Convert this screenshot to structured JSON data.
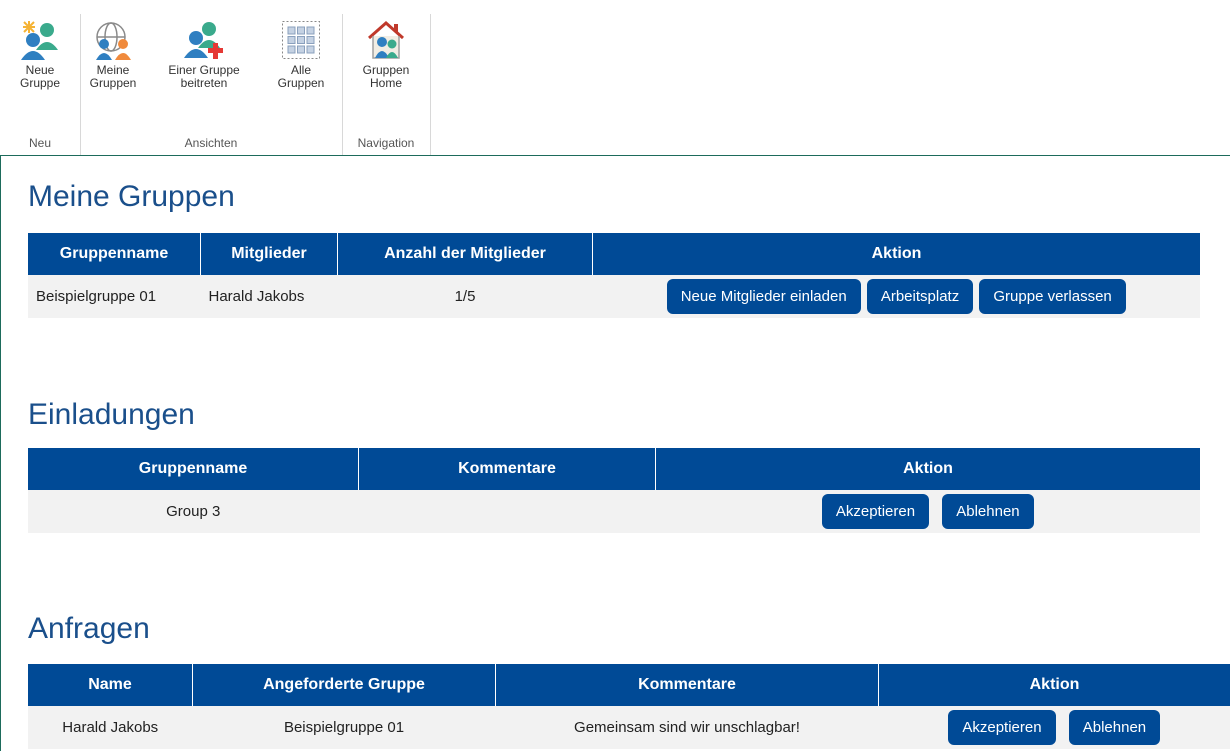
{
  "ribbon": {
    "groups": [
      {
        "label": "Neu",
        "buttons": [
          {
            "label": "Neue\nGruppe",
            "icon": "new-group-icon"
          }
        ]
      },
      {
        "label": "Ansichten",
        "buttons": [
          {
            "label": "Meine\nGruppen",
            "icon": "my-groups-icon"
          },
          {
            "label": "Einer Gruppe\nbeitreten",
            "icon": "join-group-icon"
          },
          {
            "label": "Alle\nGruppen",
            "icon": "all-groups-icon"
          }
        ]
      },
      {
        "label": "Navigation",
        "buttons": [
          {
            "label": "Gruppen\nHome",
            "icon": "group-home-icon"
          }
        ]
      }
    ]
  },
  "colors": {
    "header_bg": "#004a96",
    "button_bg": "#004a96",
    "title": "#1a4f8b",
    "row_bg": "#f2f2f2"
  },
  "my_groups": {
    "title": "Meine Gruppen",
    "columns": [
      "Gruppenname",
      "Mitglieder",
      "Anzahl der Mitglieder",
      "Aktion"
    ],
    "rows": [
      {
        "name": "Beispielgruppe 01",
        "members": "Harald Jakobs",
        "count": "1/5",
        "actions": [
          "Neue Mitglieder einladen",
          "Arbeitsplatz",
          "Gruppe verlassen"
        ]
      }
    ]
  },
  "invitations": {
    "title": "Einladungen",
    "columns": [
      "Gruppenname",
      "Kommentare",
      "Aktion"
    ],
    "rows": [
      {
        "name": "Group 3",
        "comment": "",
        "actions": [
          "Akzeptieren",
          "Ablehnen"
        ]
      }
    ]
  },
  "requests": {
    "title": "Anfragen",
    "columns": [
      "Name",
      "Angeforderte Gruppe",
      "Kommentare",
      "Aktion"
    ],
    "rows": [
      {
        "name": "Harald Jakobs",
        "group": "Beispielgruppe 01",
        "comment": "Gemeinsam sind wir unschlagbar!",
        "actions": [
          "Akzeptieren",
          "Ablehnen"
        ]
      }
    ]
  }
}
